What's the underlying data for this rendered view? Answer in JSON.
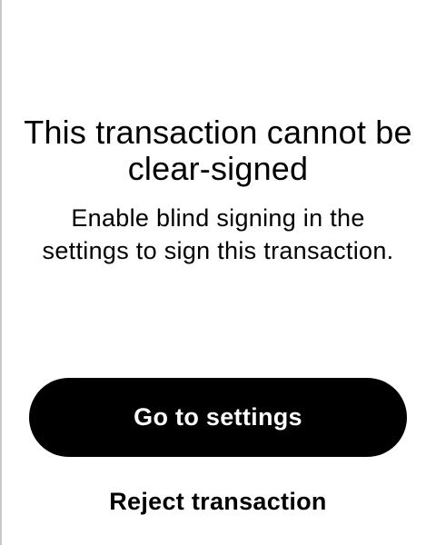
{
  "dialog": {
    "title": "This transaction cannot be clear-signed",
    "message": "Enable blind signing in the settings to sign this transaction.",
    "primary_button_label": "Go to settings",
    "secondary_button_label": "Reject transaction"
  },
  "colors": {
    "background": "#ffffff",
    "text": "#000000",
    "primary_button_bg": "#000000",
    "primary_button_text": "#ffffff"
  }
}
